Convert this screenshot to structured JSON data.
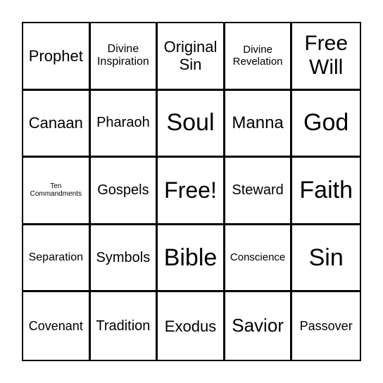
{
  "board": {
    "cells": [
      [
        "Prophet",
        "Divine\nInspiration",
        "Original\nSin",
        "Divine\nRevelation",
        "Free\nWill"
      ],
      [
        "Canaan",
        "Pharaoh",
        "Soul",
        "Manna",
        "God"
      ],
      [
        "Ten\nCommandments",
        "Gospels",
        "Free!",
        "Steward",
        "Faith"
      ],
      [
        "Separation",
        "Symbols",
        "Bible",
        "Conscience",
        "Sin"
      ],
      [
        "Covenant",
        "Tradition",
        "Exodus",
        "Savior",
        "Passover"
      ]
    ],
    "free_space_label": "Free!"
  }
}
